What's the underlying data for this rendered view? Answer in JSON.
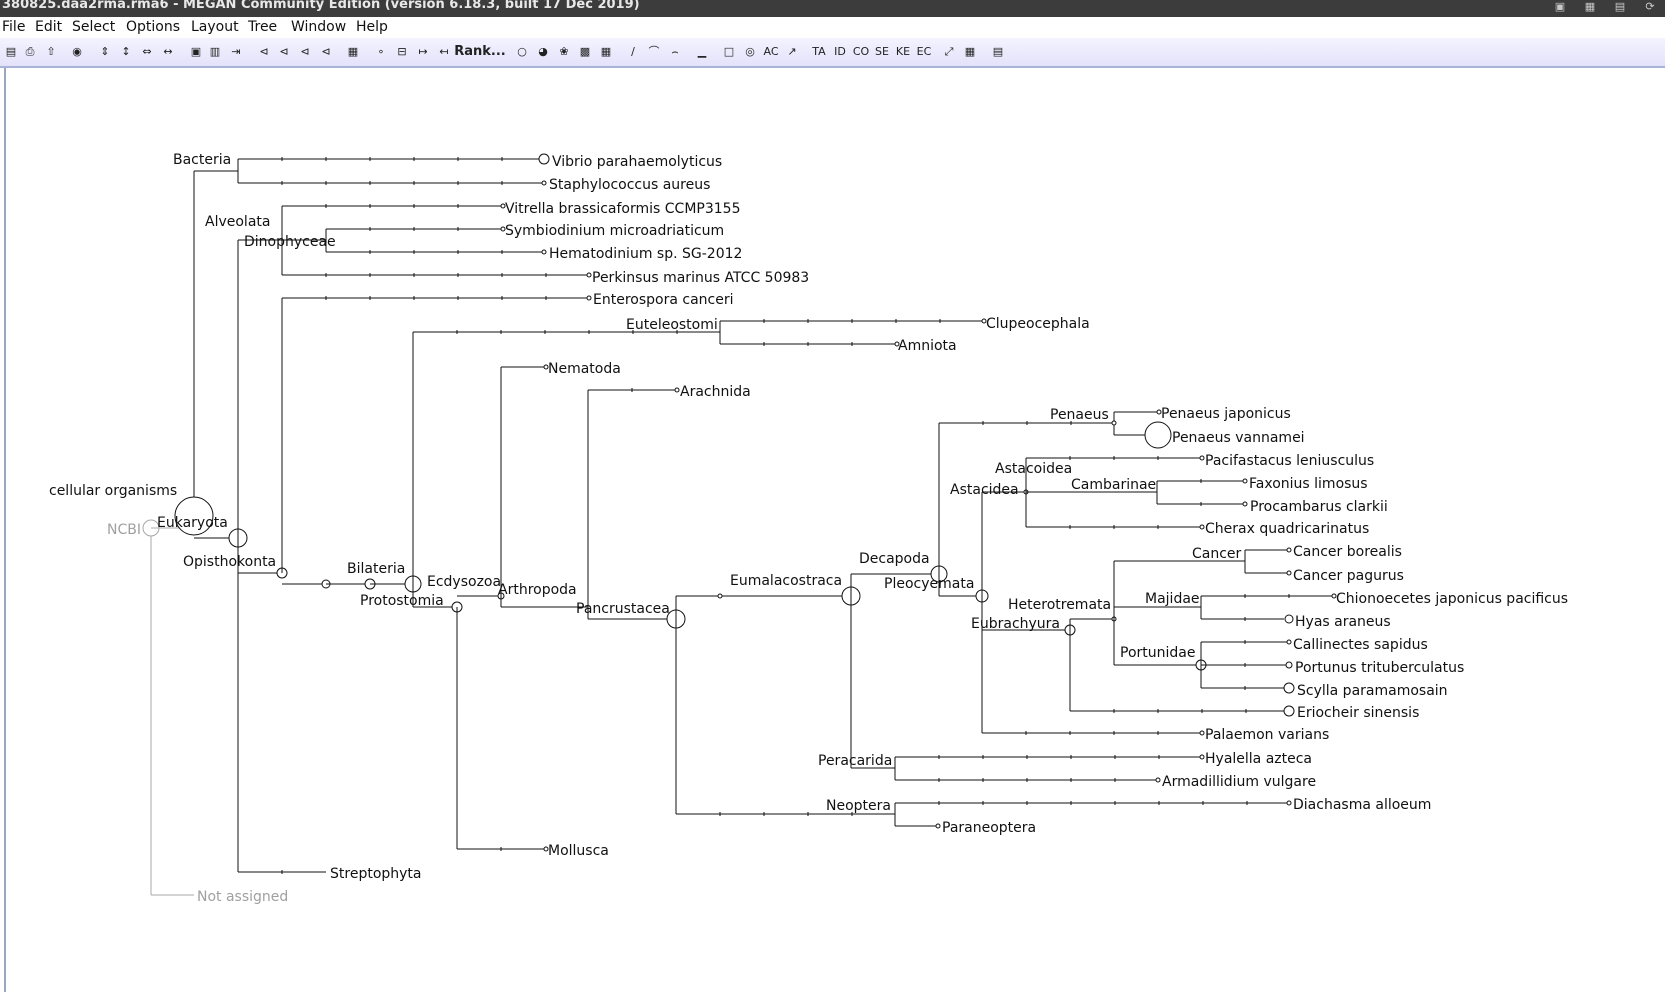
{
  "window": {
    "title": "380825.daa2rma.rma6 - MEGAN Community Edition (version 6.18.3, built 17 Dec 2019)"
  },
  "tray_icons": [
    "monitor-icon",
    "display-settings-icon",
    "clipboard-icon",
    "network-icon"
  ],
  "menu": [
    {
      "id": "file",
      "label": "File"
    },
    {
      "id": "edit",
      "label": "Edit"
    },
    {
      "id": "select",
      "label": "Select"
    },
    {
      "id": "options",
      "label": "Options"
    },
    {
      "id": "layout",
      "label": "Layout"
    },
    {
      "id": "tree",
      "label": "Tree"
    },
    {
      "id": "window",
      "label": "Window"
    },
    {
      "id": "help",
      "label": "Help"
    }
  ],
  "toolbar": {
    "rank_label": "Rank...",
    "buttons": [
      "open-icon",
      "print-icon",
      "export-icon",
      "find-icon",
      "expand-vertical-icon",
      "contract-vertical-icon",
      "expand-horizontal-icon",
      "contract-horizontal-icon",
      "collapse-icon",
      "uncollapse-icon",
      "collapse-rank-icon",
      "tree-view-icon",
      "tree-collapsed-icon",
      "tree-expanded-icon",
      "tree-subtree-icon",
      "heatmap-icon",
      "node-icon",
      "node-box-icon",
      "node-arrow-icon",
      "node-leaf-icon",
      "circle-node-icon",
      "pie-chart-icon",
      "coxcomb-icon",
      "heatmap-node-icon",
      "grid-icon",
      "straight-edge-icon",
      "curved-edge-icon",
      "angled-edge-icon",
      "bar-chart-icon",
      "layout-rect-icon",
      "layout-radial-icon",
      "label-ac-icon",
      "scale-icon",
      "taxa-label-icon",
      "id-label-icon",
      "cog-label-icon",
      "seed-label-icon",
      "kegg-label-icon",
      "ec-label-icon",
      "fit-icon",
      "table-icon",
      "panel-icon"
    ]
  },
  "tree": {
    "nodes": {
      "ncbi": "NCBI",
      "cellular_organisms": "cellular organisms",
      "eukaryota": "Eukaryota",
      "not_assigned": "Not assigned",
      "bacteria": "Bacteria",
      "vibrio": "Vibrio parahaemolyticus",
      "staphylococcus": "Staphylococcus aureus",
      "alveolata": "Alveolata",
      "dinophyceae": "Dinophyceae",
      "vitrella": "Vitrella brassicaformis CCMP3155",
      "symbiodinium": "Symbiodinium microadriaticum",
      "hematodinium": "Hematodinium sp. SG-2012",
      "perkinsus": "Perkinsus marinus ATCC 50983",
      "enterospora": "Enterospora canceri",
      "opisthokonta": "Opisthokonta",
      "streptophyta": "Streptophyta",
      "bilateria": "Bilateria",
      "ecdysozoa": "Ecdysozoa",
      "protostomia": "Protostomia",
      "euteleostomi": "Euteleostomi",
      "clupeocephala": "Clupeocephala",
      "amniota": "Amniota",
      "nematoda": "Nematoda",
      "mollusca": "Mollusca",
      "arthropoda": "Arthropoda",
      "arachnida": "Arachnida",
      "pancrustacea": "Pancrustacea",
      "eumalacostraca": "Eumalacostraca",
      "neoptera": "Neoptera",
      "diachasma": "Diachasma alloeum",
      "paraneoptera": "Paraneoptera",
      "decapoda": "Decapoda",
      "peracarida": "Peracarida",
      "hyalella": "Hyalella azteca",
      "armadillidium": "Armadillidium vulgare",
      "pleocyemata": "Pleocyemata",
      "penaeus": "Penaeus",
      "penaeus_japonicus": "Penaeus japonicus",
      "penaeus_vannamei": "Penaeus vannamei",
      "astacidea": "Astacidea",
      "astacoidea": "Astacoidea",
      "pacifastacus": "Pacifastacus leniusculus",
      "cambarinae": "Cambarinae",
      "faxonius": "Faxonius limosus",
      "procambarus": "Procambarus clarkii",
      "cherax": "Cherax quadricarinatus",
      "heterotremata": "Heterotremata",
      "eubrachyura": "Eubrachyura",
      "cancer": "Cancer",
      "cancer_borealis": "Cancer borealis",
      "cancer_pagurus": "Cancer pagurus",
      "majidae": "Majidae",
      "chionoecetes": "Chionoecetes japonicus pacificus",
      "hyas": "Hyas araneus",
      "portunidae": "Portunidae",
      "callinectes": "Callinectes sapidus",
      "portunus": "Portunus trituberculatus",
      "scylla": "Scylla paramamosain",
      "eriocheir": "Eriocheir sinensis",
      "palaemon": "Palaemon varians"
    }
  }
}
